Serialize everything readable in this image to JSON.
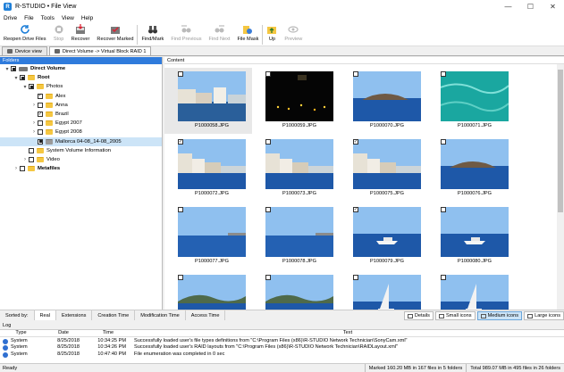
{
  "window": {
    "title": "R-STUDIO • File View",
    "icon_letter": "R"
  },
  "menu": [
    "Drive",
    "File",
    "Tools",
    "View",
    "Help"
  ],
  "toolbar": [
    {
      "label": "Reopen Drive Files",
      "icon": "refresh-icon",
      "disabled": false
    },
    {
      "label": "Stop",
      "icon": "stop-icon",
      "disabled": true
    },
    {
      "label": "Recover",
      "icon": "recover-icon",
      "disabled": false
    },
    {
      "label": "Recover Marked",
      "icon": "recover-marked-icon",
      "disabled": false
    },
    {
      "label": "Find/Mark",
      "icon": "binoculars-icon",
      "disabled": false
    },
    {
      "label": "Find Previous",
      "icon": "find-previous-icon",
      "disabled": true
    },
    {
      "label": "Find Next",
      "icon": "find-next-icon",
      "disabled": true
    },
    {
      "label": "File Mask",
      "icon": "file-mask-icon",
      "disabled": false
    },
    {
      "label": "Up",
      "icon": "folder-up-icon",
      "disabled": false
    },
    {
      "label": "Preview",
      "icon": "preview-icon",
      "disabled": true
    }
  ],
  "tabs": [
    {
      "label": "Device view",
      "active": false
    },
    {
      "label": "Direct Volume -> Virtual Block RAID 1",
      "active": true
    }
  ],
  "folders": {
    "header": "Folders",
    "items": [
      {
        "label": "Direct Volume",
        "bold": true,
        "expander": "▾",
        "checkbox": "filled",
        "icon": "disk"
      },
      {
        "label": "Root",
        "bold": true,
        "expander": "▾",
        "checkbox": "filled",
        "icon": "folder"
      },
      {
        "label": "Photos",
        "bold": false,
        "expander": "▾",
        "checkbox": "filled",
        "icon": "folder"
      },
      {
        "label": "Alex",
        "bold": false,
        "expander": "",
        "checkbox": "checked",
        "icon": "folder"
      },
      {
        "label": "Anna",
        "bold": false,
        "expander": "›",
        "checkbox": "empty",
        "icon": "folder"
      },
      {
        "label": "Brazil",
        "bold": false,
        "expander": "",
        "checkbox": "checked",
        "icon": "folder"
      },
      {
        "label": "Egypt 2007",
        "bold": false,
        "expander": "›",
        "checkbox": "empty",
        "icon": "folder"
      },
      {
        "label": "Egypt 2008",
        "bold": false,
        "expander": "›",
        "checkbox": "empty",
        "icon": "folder"
      },
      {
        "label": "Mallorca 04-08_14-08_2005",
        "bold": false,
        "expander": "",
        "checkbox": "filled",
        "icon": "folder-gray",
        "selected": true
      },
      {
        "label": "System Volume Information",
        "bold": false,
        "expander": "",
        "checkbox": "empty",
        "icon": "folder"
      },
      {
        "label": "Video",
        "bold": false,
        "expander": "›",
        "checkbox": "empty",
        "icon": "folder"
      },
      {
        "label": "Metafiles",
        "bold": true,
        "expander": "›",
        "checkbox": "empty",
        "icon": "folder"
      }
    ]
  },
  "content": {
    "header": "Content",
    "files": [
      {
        "name": "P1000058.JPG",
        "checked": false,
        "scene": "harbor-buildings"
      },
      {
        "name": "P1000059.JPG",
        "checked": false,
        "scene": "night-lights"
      },
      {
        "name": "P1000070.JPG",
        "checked": false,
        "scene": "island"
      },
      {
        "name": "P1000071.JPG",
        "checked": false,
        "scene": "turquoise-water"
      },
      {
        "name": "P1000072.JPG",
        "checked": true,
        "scene": "coast-buildings"
      },
      {
        "name": "P1000073.JPG",
        "checked": false,
        "scene": "coast-buildings"
      },
      {
        "name": "P1000075.JPG",
        "checked": true,
        "scene": "coast-buildings"
      },
      {
        "name": "P1000076.JPG",
        "checked": false,
        "scene": "island"
      },
      {
        "name": "P1000077.JPG",
        "checked": false,
        "scene": "sea-horizon"
      },
      {
        "name": "P1000078.JPG",
        "checked": false,
        "scene": "sea-horizon"
      },
      {
        "name": "P1000079.JPG",
        "checked": true,
        "scene": "boat"
      },
      {
        "name": "P1000080.JPG",
        "checked": false,
        "scene": "boat"
      },
      {
        "name": "",
        "checked": false,
        "scene": "hills"
      },
      {
        "name": "",
        "checked": false,
        "scene": "hills"
      },
      {
        "name": "",
        "checked": false,
        "scene": "sailboat"
      },
      {
        "name": "",
        "checked": false,
        "scene": "sailboat"
      }
    ]
  },
  "sortbar": {
    "label": "Sorted by:",
    "items": [
      {
        "label": "Real",
        "active": true
      },
      {
        "label": "Extensions",
        "active": false
      },
      {
        "label": "Creation Time",
        "active": false
      },
      {
        "label": "Modification Time",
        "active": false
      },
      {
        "label": "Access Time",
        "active": false
      }
    ],
    "views": [
      {
        "label": "Details",
        "active": false
      },
      {
        "label": "Small icons",
        "active": false
      },
      {
        "label": "Medium icons",
        "active": true
      },
      {
        "label": "Large icons",
        "active": false
      }
    ]
  },
  "log": {
    "title": "Log",
    "columns": [
      "Type",
      "Date",
      "Time",
      "Text"
    ],
    "rows": [
      {
        "type": "System",
        "date": "8/25/2018",
        "time": "10:34:25 PM",
        "text": "Successfully loaded user's file types definitions from \"C:\\Program Files (x86)\\R-STUDIO Network Technician\\SonyCam.xml\""
      },
      {
        "type": "System",
        "date": "8/25/2018",
        "time": "10:34:26 PM",
        "text": "Successfully loaded user's RAID layouts from \"C:\\Program Files (x86)\\R-STUDIO Network Technician\\RAIDLayout.xml\""
      },
      {
        "type": "System",
        "date": "8/25/2018",
        "time": "10:47:40 PM",
        "text": "File enumeration was completed in 0 sec"
      }
    ]
  },
  "status": {
    "ready": "Ready",
    "marked": "Marked 160.20 MB in 167 files in 5 folders",
    "total": "Total 989.07 MB in 495 files in 26 folders"
  }
}
